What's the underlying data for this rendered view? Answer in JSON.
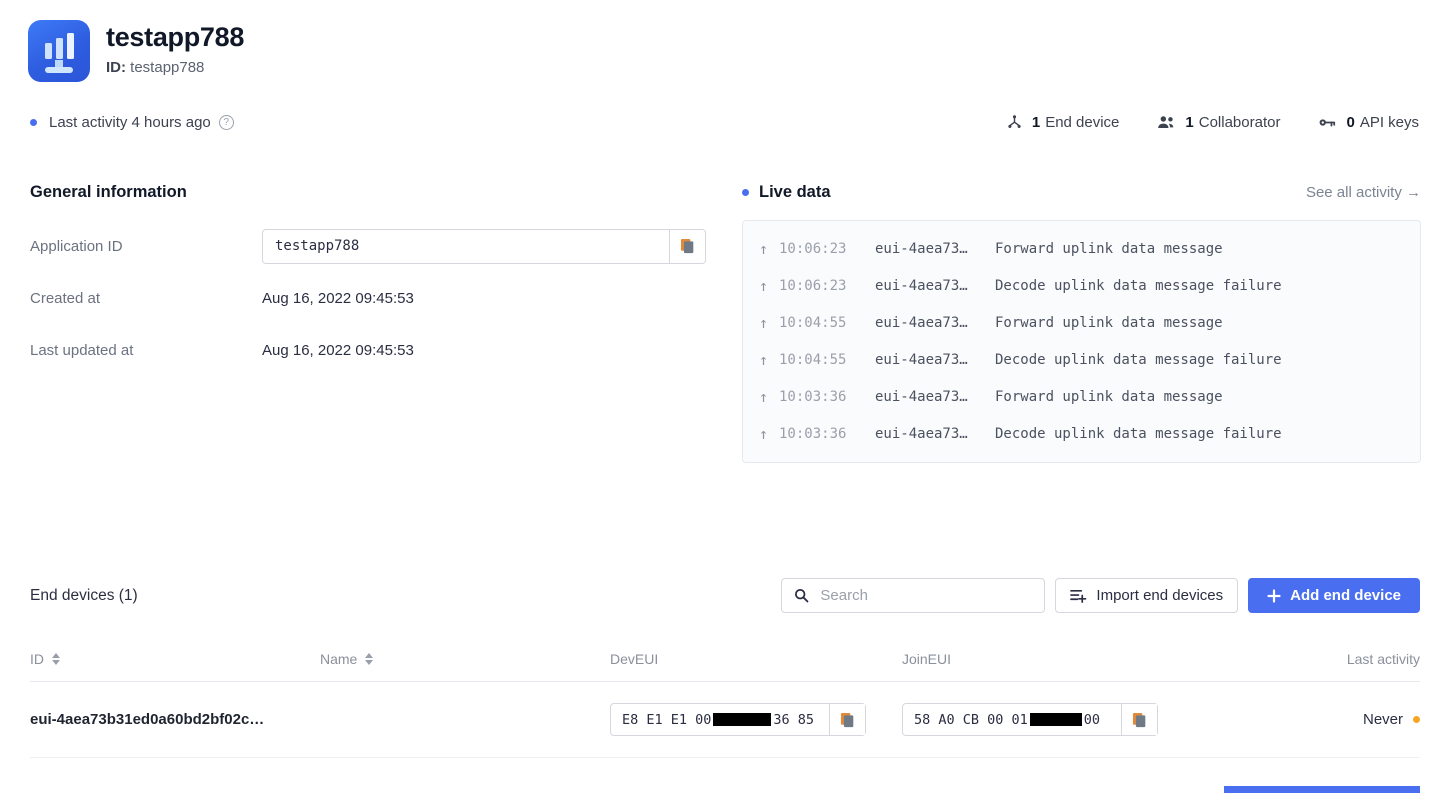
{
  "app": {
    "icon": "application-monitor-chart-icon",
    "title": "testapp788",
    "id_label": "ID:",
    "id_value": "testapp788"
  },
  "meta": {
    "last_activity": "Last activity 4 hours ago",
    "help_icon": "?",
    "status_dot_color": "#4a6ef0",
    "stats": [
      {
        "icon": "end-device-icon",
        "count": "1",
        "label": "End device"
      },
      {
        "icon": "collaborators-icon",
        "count": "1",
        "label": "Collaborator"
      },
      {
        "icon": "api-key-icon",
        "count": "0",
        "label": "API keys"
      }
    ]
  },
  "general": {
    "title": "General information",
    "application_id_label": "Application ID",
    "application_id_value": "testapp788",
    "created_at_label": "Created at",
    "created_at_value": "Aug 16, 2022 09:45:53",
    "last_updated_label": "Last updated at",
    "last_updated_value": "Aug 16, 2022 09:45:53"
  },
  "live_data": {
    "title": "Live data",
    "see_all": "See all activity →",
    "rows": [
      {
        "direction": "↑",
        "time": "10:06:23",
        "device": "eui-4aea73…",
        "message": "Forward uplink data message"
      },
      {
        "direction": "↑",
        "time": "10:06:23",
        "device": "eui-4aea73…",
        "message": "Decode uplink data message failure"
      },
      {
        "direction": "↑",
        "time": "10:04:55",
        "device": "eui-4aea73…",
        "message": "Forward uplink data message"
      },
      {
        "direction": "↑",
        "time": "10:04:55",
        "device": "eui-4aea73…",
        "message": "Decode uplink data message failure"
      },
      {
        "direction": "↑",
        "time": "10:03:36",
        "device": "eui-4aea73…",
        "message": "Forward uplink data message"
      },
      {
        "direction": "↑",
        "time": "10:03:36",
        "device": "eui-4aea73…",
        "message": "Decode uplink data message failure"
      }
    ]
  },
  "end_devices": {
    "title": "End devices (1)",
    "search_placeholder": "Search",
    "import_label": "Import end devices",
    "add_label": "Add end device",
    "columns": {
      "id": "ID",
      "name": "Name",
      "deveui": "DevEUI",
      "joineui": "JoinEUI",
      "last_activity": "Last activity"
    },
    "rows": [
      {
        "id": "eui-4aea73b31ed0a60bd2bf02c…",
        "name": "",
        "deveui_prefix": "E8 E1 E1 00 ",
        "deveui_suffix": " 36 85",
        "joineui_prefix": "58 A0 CB 00 01",
        "joineui_suffix": " 00",
        "last_activity": "Never",
        "last_activity_dot_color": "#f6a623"
      }
    ]
  },
  "colors": {
    "primary": "#4a6ef0",
    "amber": "#f6a623"
  }
}
